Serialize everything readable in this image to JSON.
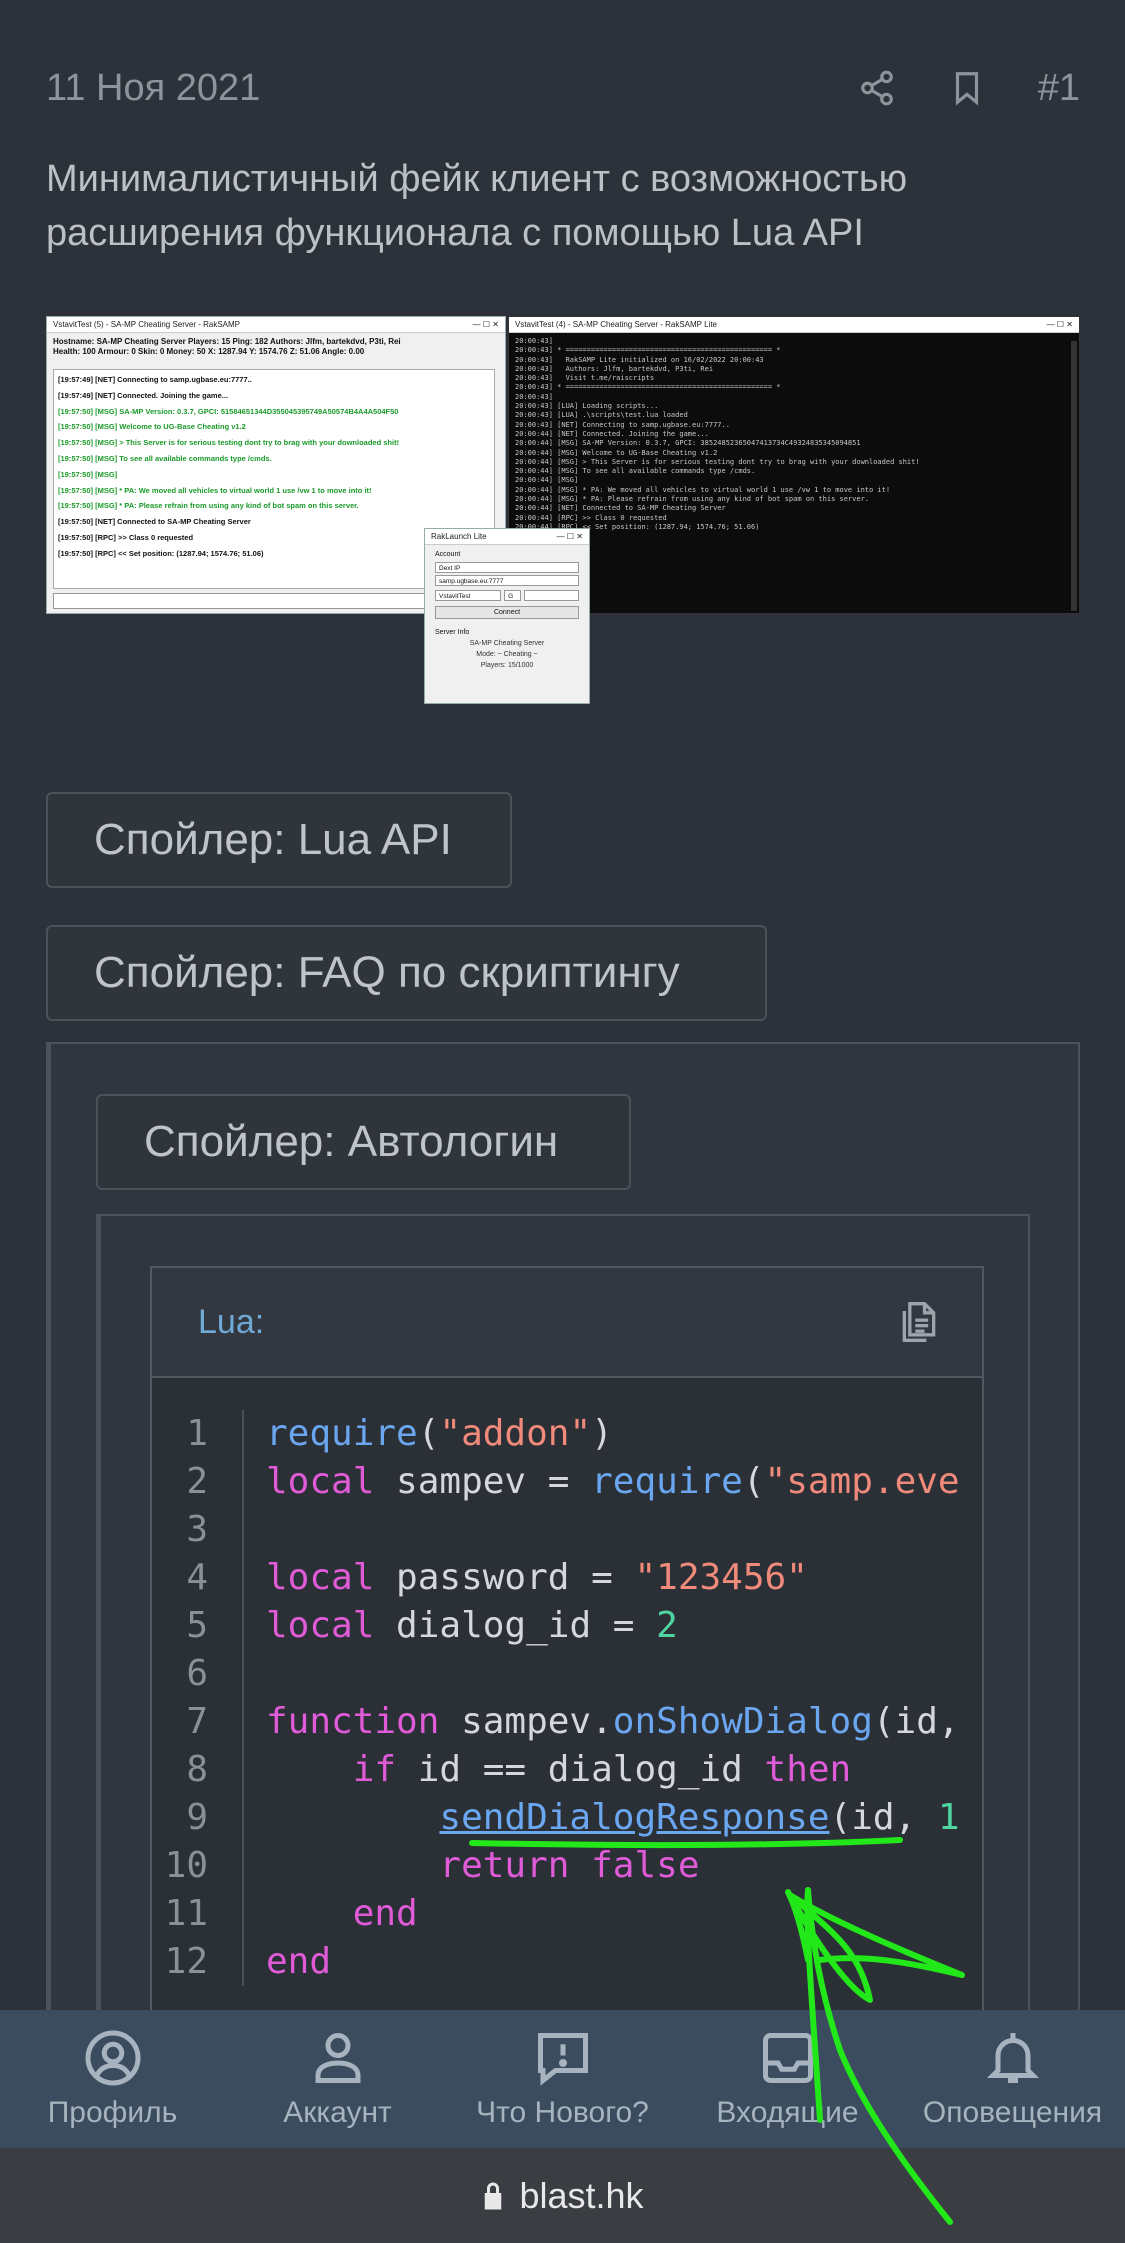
{
  "post": {
    "date": "11 Ноя 2021",
    "number": "#1",
    "text": "Минималистичный фейк клиент с возможностью расширения функционала с помощью Lua API"
  },
  "screens": {
    "client_title": "VstavitTest (5) - SA-MP Cheating Server - RakSAMP",
    "client_header_1": "Hostname: SA-MP Cheating Server    Players: 15    Ping: 182    Authors: Jlfm, bartekdvd, P3ti, Rei",
    "client_header_2": "Health: 100    Armour: 0    Skin: 0    Money: 50    X: 1287.94    Y: 1574.76    Z: 51.06    Angle: 0.00",
    "client_log": [
      "[19:57:49] [NET] Connecting to samp.ugbase.eu:7777..",
      "[19:57:49] [NET] Connected. Joining the game...",
      "[19:57:50] [MSG] SA-MP Version: 0.3.7, GPCI: 51584651344D355045395749A50574B4A4A504F50",
      "[19:57:50] [MSG] Welcome to UG-Base Cheating v1.2",
      "[19:57:50] [MSG] > This Server is for serious testing dont try to brag with your downloaded shit!",
      "[19:57:50] [MSG] To see all available commands type /cmds.",
      "[19:57:50] [MSG]",
      "[19:57:50] [MSG] * PA: We moved all vehicles to virtual world 1 use /vw 1 to move into it!",
      "[19:57:50] [MSG] * PA: Please refrain from using any kind of bot spam on this server.",
      "[19:57:50] [NET] Connected to SA-MP Cheating Server",
      "[19:57:50] [RPC] >> Class 0 requested",
      "[19:57:50] [RPC] << Set position: (1287.94; 1574.76; 51.06)"
    ],
    "console_title": "VstavitTest (4) - SA-MP Cheating Server - RakSAMP Lite",
    "console_text": "20:00:43]\n20:00:43] * ================================================= *\n20:00:43]   RakSAMP Lite initialized on 16/02/2022 20:00:43\n20:00:43]   Authors: Jlfm, bartekdvd, P3ti, Rei\n20:00:43]   Visit t.me/raiscripts\n20:00:43] * ================================================= *\n20:00:43]\n20:00:43] [LUA] Loading scripts...\n20:00:43] [LUA] .\\scripts\\test.lua loaded\n20:00:43] [NET] Connecting to samp.ugbase.eu:7777..\n20:00:44] [NET] Connected. Joining the game...\n20:00:44] [MSG] SA-MP Version: 0.3.7, GPCI: 38524852365047413734C49324835345094851\n20:00:44] [MSG] Welcome to UG-Base Cheating v1.2\n20:00:44] [MSG] > This Server is for serious testing dont try to brag with your downloaded shit!\n20:00:44] [MSG] To see all available commands type /cmds.\n20:00:44] [MSG]\n20:00:44] [MSG] * PA: We moved all vehicles to virtual world 1 use /vw 1 to move into it!\n20:00:44] [MSG] * PA: Please refrain from using any kind of bot spam on this server.\n20:00:44] [NET] Connected to SA-MP Cheating Server\n20:00:44] [RPC] >> Class 0 requested\n20:00:44] [RPC] << Set position: (1287.94; 1574.76; 51.06)",
    "launcher_title": "RakLaunch Lite",
    "launcher_account": "Account",
    "launcher_select": "Dext IP",
    "launcher_host": "samp.ugbase.eu:7777",
    "launcher_nick": "VstavitTest",
    "launcher_g": "G",
    "launcher_connect": "Connect",
    "launcher_server_info": "Server Info",
    "launcher_server_name": "SA-MP Cheating Server",
    "launcher_mode": "Mode: ~ Cheating ~",
    "launcher_players": "Players: 15/1000"
  },
  "spoilers": {
    "lua_api": "Спойлер: Lua API",
    "faq": "Спойлер: FAQ по скриптингу",
    "autologin": "Спойлер: Автологин"
  },
  "code": {
    "language": "Lua:",
    "line_numbers": [
      "1",
      "2",
      "3",
      "4",
      "5",
      "6",
      "7",
      "8",
      "9",
      "10",
      "11",
      "12"
    ]
  },
  "bottom_nav": [
    {
      "label": "Профиль",
      "icon": "profile-icon"
    },
    {
      "label": "Аккаунт",
      "icon": "account-icon"
    },
    {
      "label": "Что Нового?",
      "icon": "whats-new-icon"
    },
    {
      "label": "Входящие",
      "icon": "inbox-icon"
    },
    {
      "label": "Оповещения",
      "icon": "bell-icon"
    }
  ],
  "url": "blast.hk",
  "colors": {
    "background": "#2d3139",
    "nav_bar": "#3a4c5e",
    "annotation": "#22e81a",
    "keyword": "#e05bd8",
    "function": "#6aa7f0",
    "string": "#f08a7a",
    "number": "#4fd6a0"
  }
}
